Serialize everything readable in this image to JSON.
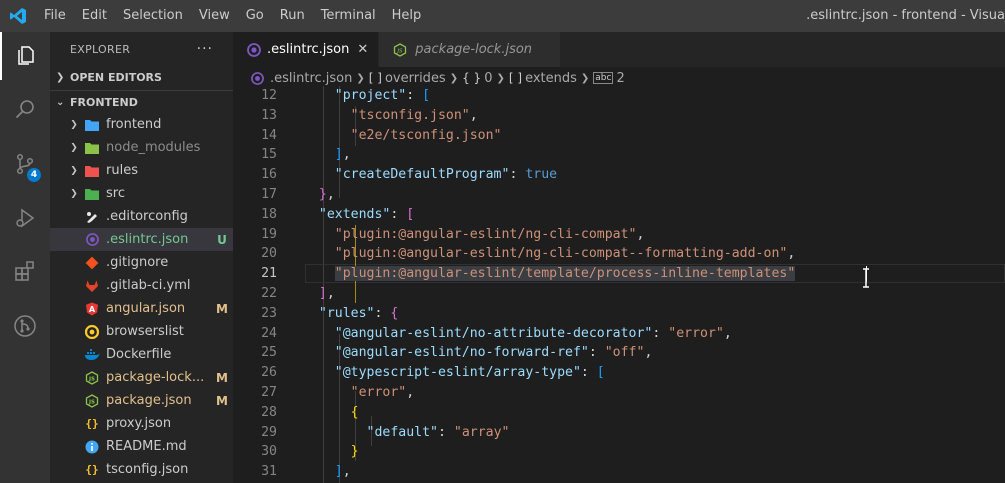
{
  "menu": [
    "File",
    "Edit",
    "Selection",
    "View",
    "Go",
    "Run",
    "Terminal",
    "Help"
  ],
  "window_title": ".eslintrc.json - frontend - Visua",
  "activity": {
    "scm_badge": "4"
  },
  "explorer": {
    "header": "EXPLORER",
    "more": "···",
    "open_editors": "OPEN EDITORS",
    "folder": "FRONTEND",
    "items": [
      {
        "label": "frontend",
        "type": "folder",
        "icon_color": "#42a5f5",
        "status": ""
      },
      {
        "label": "node_modules",
        "type": "folder",
        "icon_color": "#8bc34a",
        "status": "",
        "dim": true
      },
      {
        "label": "rules",
        "type": "folder",
        "icon_color": "#ef5350",
        "status": ""
      },
      {
        "label": "src",
        "type": "folder",
        "icon_color": "#4caf50",
        "status": ""
      },
      {
        "label": ".editorconfig",
        "type": "file",
        "icon": "editorconfig-icon",
        "icon_color": "#e8e8e8",
        "status": ""
      },
      {
        "label": ".eslintrc.json",
        "type": "file",
        "icon": "eslint-icon",
        "icon_color": "#7e57c2",
        "status": "U",
        "status_color": "#73c991",
        "label_color": "#73c991",
        "selected": true
      },
      {
        "label": ".gitignore",
        "type": "file",
        "icon": "git-icon",
        "icon_color": "#f4511e",
        "status": ""
      },
      {
        "label": ".gitlab-ci.yml",
        "type": "file",
        "icon": "gitlab-icon",
        "icon_color": "#e24329",
        "status": ""
      },
      {
        "label": "angular.json",
        "type": "file",
        "icon": "angular-icon",
        "icon_color": "#e53935",
        "status": "M",
        "status_color": "#e2c08d",
        "label_color": "#e2c08d"
      },
      {
        "label": "browserslist",
        "type": "file",
        "icon": "browserslist-icon",
        "icon_color": "#ffca28",
        "status": ""
      },
      {
        "label": "Dockerfile",
        "type": "file",
        "icon": "docker-icon",
        "icon_color": "#0288d1",
        "status": ""
      },
      {
        "label": "package-lock...",
        "type": "file",
        "icon": "nodejs-icon",
        "icon_color": "#8bc34a",
        "status": "M",
        "status_color": "#e2c08d",
        "label_color": "#e2c08d"
      },
      {
        "label": "package.json",
        "type": "file",
        "icon": "nodejs-icon",
        "icon_color": "#8bc34a",
        "status": "M",
        "status_color": "#e2c08d",
        "label_color": "#e2c08d"
      },
      {
        "label": "proxy.json",
        "type": "file",
        "icon": "json-icon",
        "icon_color": "#fbc02d",
        "status": ""
      },
      {
        "label": "README.md",
        "type": "file",
        "icon": "info-icon",
        "icon_color": "#42a5f5",
        "status": ""
      },
      {
        "label": "tsconfig.json",
        "type": "file",
        "icon": "json-icon",
        "icon_color": "#fbc02d",
        "status": ""
      }
    ]
  },
  "tabs": [
    {
      "label": ".eslintrc.json",
      "active": true,
      "close": "✕"
    },
    {
      "label": "package-lock.json",
      "active": false
    }
  ],
  "breadcrumbs": [
    ".eslintrc.json",
    "overrides",
    "0",
    "extends",
    "2"
  ],
  "breadcrumb_symbols": [
    "[ ]",
    "{ }",
    "[ ]",
    "abc"
  ],
  "code": [
    {
      "n": "12",
      "tokens": [
        [
          "    ",
          "p"
        ],
        [
          "\"project\"",
          "k"
        ],
        [
          ": ",
          "p"
        ],
        [
          "[",
          "b3"
        ]
      ]
    },
    {
      "n": "13",
      "tokens": [
        [
          "      ",
          "p"
        ],
        [
          "\"tsconfig.json\"",
          "s"
        ],
        [
          ",",
          "p"
        ]
      ]
    },
    {
      "n": "14",
      "tokens": [
        [
          "      ",
          "p"
        ],
        [
          "\"e2e/tsconfig.json\"",
          "s"
        ]
      ]
    },
    {
      "n": "15",
      "tokens": [
        [
          "    ",
          "p"
        ],
        [
          "]",
          "b3"
        ],
        [
          ",",
          "p"
        ]
      ]
    },
    {
      "n": "16",
      "tokens": [
        [
          "    ",
          "p"
        ],
        [
          "\"createDefaultProgram\"",
          "k"
        ],
        [
          ": ",
          "p"
        ],
        [
          "true",
          "kw"
        ]
      ]
    },
    {
      "n": "17",
      "tokens": [
        [
          "  ",
          "p"
        ],
        [
          "}",
          "b1"
        ],
        [
          ",",
          "p"
        ]
      ]
    },
    {
      "n": "18",
      "tokens": [
        [
          "  ",
          "p"
        ],
        [
          "\"extends\"",
          "k"
        ],
        [
          ": ",
          "p"
        ],
        [
          "[",
          "b1"
        ]
      ]
    },
    {
      "n": "19",
      "tokens": [
        [
          "    ",
          "p"
        ],
        [
          "\"plugin:@angular-eslint/ng-cli-compat\"",
          "s"
        ],
        [
          ",",
          "p"
        ]
      ]
    },
    {
      "n": "20",
      "tokens": [
        [
          "    ",
          "p"
        ],
        [
          "\"plugin:@angular-eslint/ng-cli-compat--formatting-add-on\"",
          "s"
        ],
        [
          ",",
          "p"
        ]
      ]
    },
    {
      "n": "21",
      "tokens": [
        [
          "    ",
          "p"
        ],
        [
          "\"plugin:@angular-eslint/template/process-inline-templates\"",
          "s"
        ]
      ]
    },
    {
      "n": "22",
      "tokens": [
        [
          "  ",
          "p"
        ],
        [
          "]",
          "b1"
        ],
        [
          ",",
          "p"
        ]
      ]
    },
    {
      "n": "23",
      "tokens": [
        [
          "  ",
          "p"
        ],
        [
          "\"rules\"",
          "k"
        ],
        [
          ": ",
          "p"
        ],
        [
          "{",
          "b1"
        ]
      ]
    },
    {
      "n": "24",
      "tokens": [
        [
          "    ",
          "p"
        ],
        [
          "\"@angular-eslint/no-attribute-decorator\"",
          "k"
        ],
        [
          ": ",
          "p"
        ],
        [
          "\"error\"",
          "s"
        ],
        [
          ",",
          "p"
        ]
      ]
    },
    {
      "n": "25",
      "tokens": [
        [
          "    ",
          "p"
        ],
        [
          "\"@angular-eslint/no-forward-ref\"",
          "k"
        ],
        [
          ": ",
          "p"
        ],
        [
          "\"off\"",
          "s"
        ],
        [
          ",",
          "p"
        ]
      ]
    },
    {
      "n": "26",
      "tokens": [
        [
          "    ",
          "p"
        ],
        [
          "\"@typescript-eslint/array-type\"",
          "k"
        ],
        [
          ": ",
          "p"
        ],
        [
          "[",
          "b3"
        ]
      ]
    },
    {
      "n": "27",
      "tokens": [
        [
          "      ",
          "p"
        ],
        [
          "\"error\"",
          "s"
        ],
        [
          ",",
          "p"
        ]
      ]
    },
    {
      "n": "28",
      "tokens": [
        [
          "      ",
          "p"
        ],
        [
          "{",
          "b2"
        ]
      ]
    },
    {
      "n": "29",
      "tokens": [
        [
          "        ",
          "p"
        ],
        [
          "\"default\"",
          "k"
        ],
        [
          ": ",
          "p"
        ],
        [
          "\"array\"",
          "s"
        ]
      ]
    },
    {
      "n": "30",
      "tokens": [
        [
          "      ",
          "p"
        ],
        [
          "}",
          "b2"
        ]
      ]
    },
    {
      "n": "31",
      "tokens": [
        [
          "    ",
          "p"
        ],
        [
          "]",
          "b3"
        ],
        [
          ",",
          "p"
        ]
      ]
    }
  ],
  "current_line": "21"
}
